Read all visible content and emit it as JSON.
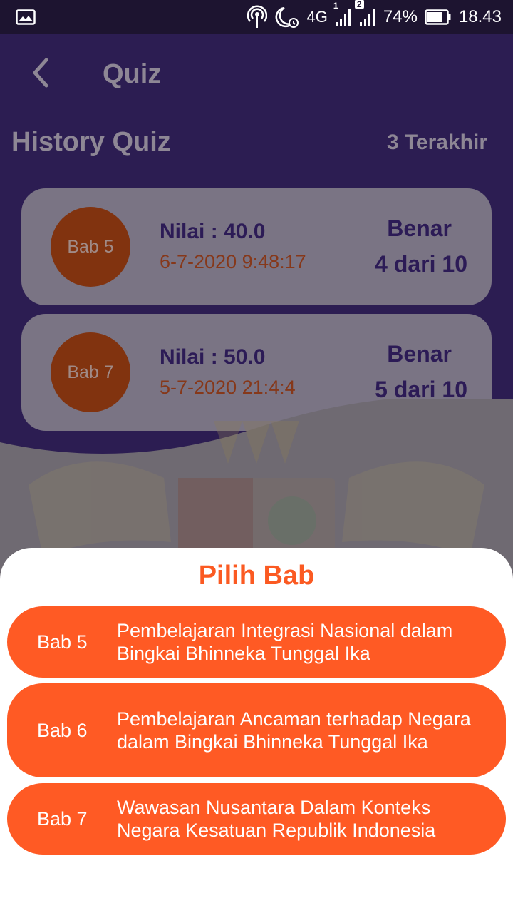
{
  "status_bar": {
    "battery": "74%",
    "time": "18.43",
    "sim_badge": "2",
    "sim1": "1",
    "network": "4G",
    "icons": [
      "image-icon",
      "hotspot-icon",
      "moon-alarm-icon",
      "signal-icon",
      "signal-icon",
      "battery-icon"
    ]
  },
  "app_bar": {
    "title": "Quiz"
  },
  "history": {
    "title": "History Quiz",
    "count_label": "3 Terakhir",
    "items": [
      {
        "bab": "Bab 5",
        "score": "Nilai : 40.0",
        "date": "6-7-2020 9:48:17",
        "benar_label": "Benar",
        "benar_value": "4 dari 10"
      },
      {
        "bab": "Bab 7",
        "score": "Nilai : 50.0",
        "date": "5-7-2020 21:4:4",
        "benar_label": "Benar",
        "benar_value": "5 dari 10"
      }
    ]
  },
  "sheet": {
    "title": "Pilih Bab",
    "chapters": [
      {
        "num": "Bab 5",
        "desc": "Pembelajaran Integrasi Nasional dalam Bingkai Bhinneka Tunggal Ika"
      },
      {
        "num": "Bab 6",
        "desc": "Pembelajaran Ancaman terhadap Negara dalam Bingkai Bhinneka Tunggal Ika"
      },
      {
        "num": "Bab 7",
        "desc": "Wawasan Nusantara Dalam Konteks Negara Kesatuan Republik Indonesia"
      }
    ]
  },
  "colors": {
    "header": "#2c1d52",
    "accent": "#ff5a24",
    "card": "#7a7484",
    "overlay": "#6b6470"
  }
}
